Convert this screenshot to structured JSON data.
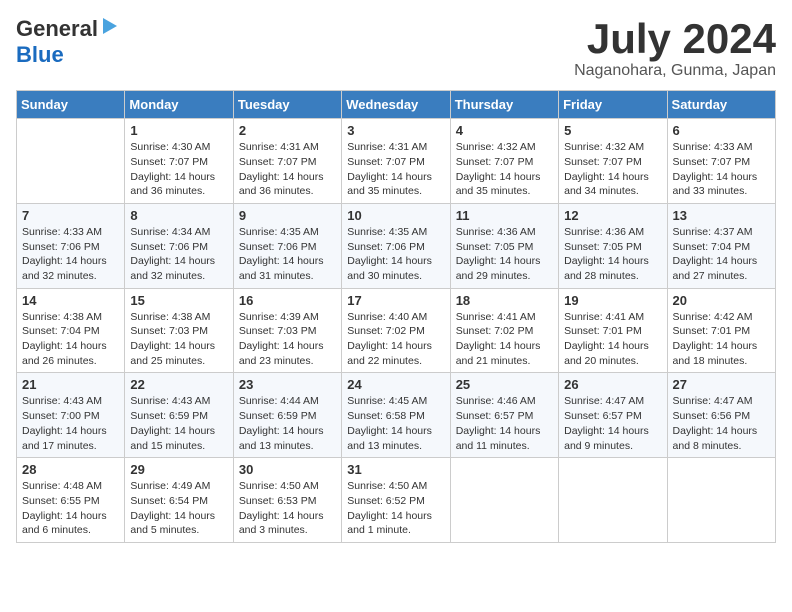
{
  "header": {
    "logo_general": "General",
    "logo_blue": "Blue",
    "month": "July 2024",
    "location": "Naganohara, Gunma, Japan"
  },
  "weekdays": [
    "Sunday",
    "Monday",
    "Tuesday",
    "Wednesday",
    "Thursday",
    "Friday",
    "Saturday"
  ],
  "weeks": [
    [
      {
        "day": "",
        "info": ""
      },
      {
        "day": "1",
        "info": "Sunrise: 4:30 AM\nSunset: 7:07 PM\nDaylight: 14 hours\nand 36 minutes."
      },
      {
        "day": "2",
        "info": "Sunrise: 4:31 AM\nSunset: 7:07 PM\nDaylight: 14 hours\nand 36 minutes."
      },
      {
        "day": "3",
        "info": "Sunrise: 4:31 AM\nSunset: 7:07 PM\nDaylight: 14 hours\nand 35 minutes."
      },
      {
        "day": "4",
        "info": "Sunrise: 4:32 AM\nSunset: 7:07 PM\nDaylight: 14 hours\nand 35 minutes."
      },
      {
        "day": "5",
        "info": "Sunrise: 4:32 AM\nSunset: 7:07 PM\nDaylight: 14 hours\nand 34 minutes."
      },
      {
        "day": "6",
        "info": "Sunrise: 4:33 AM\nSunset: 7:07 PM\nDaylight: 14 hours\nand 33 minutes."
      }
    ],
    [
      {
        "day": "7",
        "info": "Sunrise: 4:33 AM\nSunset: 7:06 PM\nDaylight: 14 hours\nand 32 minutes."
      },
      {
        "day": "8",
        "info": "Sunrise: 4:34 AM\nSunset: 7:06 PM\nDaylight: 14 hours\nand 32 minutes."
      },
      {
        "day": "9",
        "info": "Sunrise: 4:35 AM\nSunset: 7:06 PM\nDaylight: 14 hours\nand 31 minutes."
      },
      {
        "day": "10",
        "info": "Sunrise: 4:35 AM\nSunset: 7:06 PM\nDaylight: 14 hours\nand 30 minutes."
      },
      {
        "day": "11",
        "info": "Sunrise: 4:36 AM\nSunset: 7:05 PM\nDaylight: 14 hours\nand 29 minutes."
      },
      {
        "day": "12",
        "info": "Sunrise: 4:36 AM\nSunset: 7:05 PM\nDaylight: 14 hours\nand 28 minutes."
      },
      {
        "day": "13",
        "info": "Sunrise: 4:37 AM\nSunset: 7:04 PM\nDaylight: 14 hours\nand 27 minutes."
      }
    ],
    [
      {
        "day": "14",
        "info": "Sunrise: 4:38 AM\nSunset: 7:04 PM\nDaylight: 14 hours\nand 26 minutes."
      },
      {
        "day": "15",
        "info": "Sunrise: 4:38 AM\nSunset: 7:03 PM\nDaylight: 14 hours\nand 25 minutes."
      },
      {
        "day": "16",
        "info": "Sunrise: 4:39 AM\nSunset: 7:03 PM\nDaylight: 14 hours\nand 23 minutes."
      },
      {
        "day": "17",
        "info": "Sunrise: 4:40 AM\nSunset: 7:02 PM\nDaylight: 14 hours\nand 22 minutes."
      },
      {
        "day": "18",
        "info": "Sunrise: 4:41 AM\nSunset: 7:02 PM\nDaylight: 14 hours\nand 21 minutes."
      },
      {
        "day": "19",
        "info": "Sunrise: 4:41 AM\nSunset: 7:01 PM\nDaylight: 14 hours\nand 20 minutes."
      },
      {
        "day": "20",
        "info": "Sunrise: 4:42 AM\nSunset: 7:01 PM\nDaylight: 14 hours\nand 18 minutes."
      }
    ],
    [
      {
        "day": "21",
        "info": "Sunrise: 4:43 AM\nSunset: 7:00 PM\nDaylight: 14 hours\nand 17 minutes."
      },
      {
        "day": "22",
        "info": "Sunrise: 4:43 AM\nSunset: 6:59 PM\nDaylight: 14 hours\nand 15 minutes."
      },
      {
        "day": "23",
        "info": "Sunrise: 4:44 AM\nSunset: 6:59 PM\nDaylight: 14 hours\nand 13 minutes."
      },
      {
        "day": "24",
        "info": "Sunrise: 4:45 AM\nSunset: 6:58 PM\nDaylight: 14 hours\nand 13 minutes."
      },
      {
        "day": "25",
        "info": "Sunrise: 4:46 AM\nSunset: 6:57 PM\nDaylight: 14 hours\nand 11 minutes."
      },
      {
        "day": "26",
        "info": "Sunrise: 4:47 AM\nSunset: 6:57 PM\nDaylight: 14 hours\nand 9 minutes."
      },
      {
        "day": "27",
        "info": "Sunrise: 4:47 AM\nSunset: 6:56 PM\nDaylight: 14 hours\nand 8 minutes."
      }
    ],
    [
      {
        "day": "28",
        "info": "Sunrise: 4:48 AM\nSunset: 6:55 PM\nDaylight: 14 hours\nand 6 minutes."
      },
      {
        "day": "29",
        "info": "Sunrise: 4:49 AM\nSunset: 6:54 PM\nDaylight: 14 hours\nand 5 minutes."
      },
      {
        "day": "30",
        "info": "Sunrise: 4:50 AM\nSunset: 6:53 PM\nDaylight: 14 hours\nand 3 minutes."
      },
      {
        "day": "31",
        "info": "Sunrise: 4:50 AM\nSunset: 6:52 PM\nDaylight: 14 hours\nand 1 minute."
      },
      {
        "day": "",
        "info": ""
      },
      {
        "day": "",
        "info": ""
      },
      {
        "day": "",
        "info": ""
      }
    ]
  ]
}
